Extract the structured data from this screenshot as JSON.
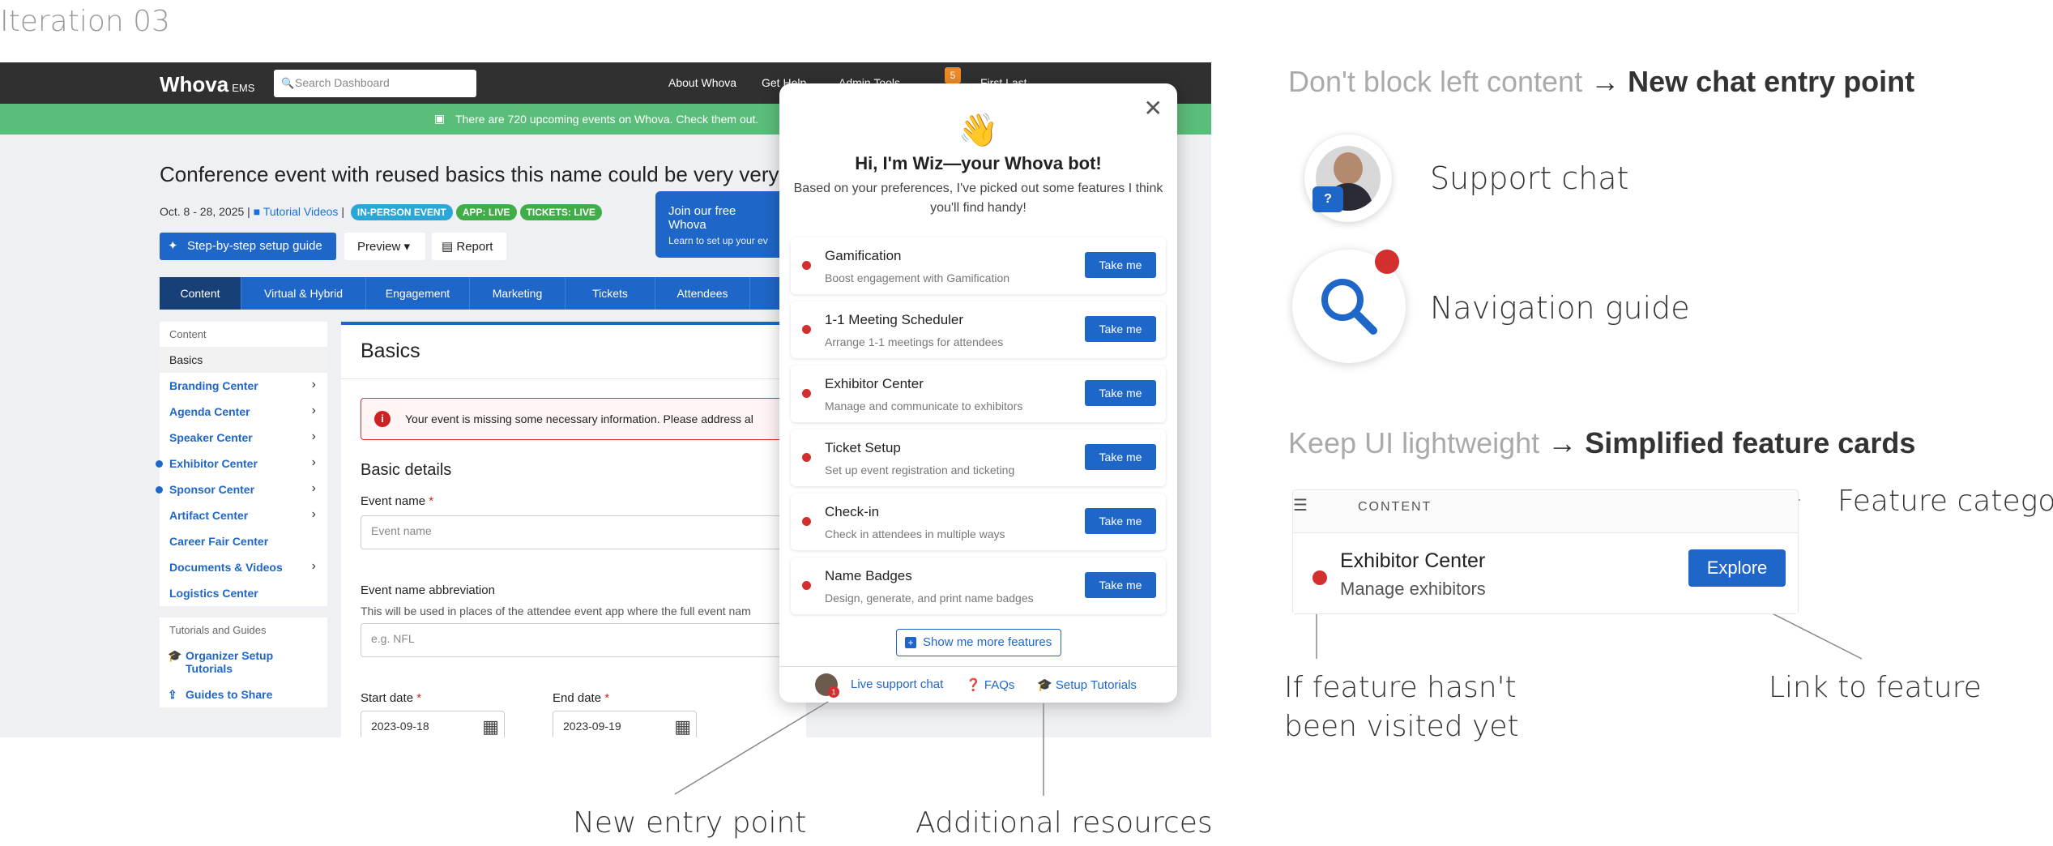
{
  "iteration_title": "Iteration 03",
  "app": {
    "logo": "Whova",
    "logo_suffix": "EMS",
    "search_placeholder": "Search Dashboard",
    "nav": [
      "About Whova",
      "Get Help",
      "Admin Tools",
      "First Last"
    ],
    "notification_count": "5",
    "banner": "There are 720 upcoming events on Whova. Check them out.",
    "event_title": "Conference event with reused basics this name could be very very lo",
    "event_dates": "Oct. 8 - 28, 2025",
    "tutorial_link": "Tutorial Videos",
    "pills": [
      {
        "label": "IN-PERSON EVENT",
        "color": "#2aa7d6"
      },
      {
        "label": "APP: LIVE",
        "color": "#3fae49"
      },
      {
        "label": "TICKETS: LIVE",
        "color": "#3fae49"
      }
    ],
    "setup_button": "Step-by-step setup guide",
    "preview_button": "Preview",
    "report_button": "Report",
    "join_title": "Join our free Whova",
    "join_sub": "Learn to set up your ev",
    "tabs": [
      "Content",
      "Virtual & Hybrid",
      "Engagement",
      "Marketing",
      "Tickets",
      "Attendees"
    ],
    "sidebar": {
      "header": "Content",
      "items": [
        {
          "label": "Basics"
        },
        {
          "label": "Branding Center"
        },
        {
          "label": "Agenda Center"
        },
        {
          "label": "Speaker Center"
        },
        {
          "label": "Exhibitor Center"
        },
        {
          "label": "Sponsor Center"
        },
        {
          "label": "Artifact Center"
        },
        {
          "label": "Career Fair Center"
        },
        {
          "label": "Documents & Videos"
        },
        {
          "label": "Logistics Center"
        }
      ],
      "guides_header": "Tutorials and Guides",
      "guides": [
        "Organizer Setup Tutorials",
        "Guides to Share"
      ]
    },
    "main": {
      "title": "Basics",
      "error": "Your event is missing some necessary information. Please address al",
      "section": "Basic details",
      "event_name_label": "Event name",
      "event_name_placeholder": "Event name",
      "abbr_label": "Event name abbreviation",
      "abbr_help": "This will be used in places of the attendee event app where the full event nam",
      "abbr_placeholder": "e.g. NFL",
      "start_label": "Start date",
      "start_value": "2023-09-18",
      "end_label": "End date",
      "end_value": "2023-09-19"
    }
  },
  "popup": {
    "wave": "👋",
    "heading": "Hi, I'm Wiz—your Whova bot!",
    "subtitle": "Based on your preferences, I've picked out some features I think you'll find handy!",
    "cards": [
      {
        "title": "Gamification",
        "sub": "Boost engagement with Gamification",
        "action": "Take me"
      },
      {
        "title": "1-1 Meeting Scheduler",
        "sub": "Arrange 1-1 meetings for attendees",
        "action": "Take me"
      },
      {
        "title": "Exhibitor Center",
        "sub": "Manage and communicate to exhibitors",
        "action": "Take me"
      },
      {
        "title": "Ticket Setup",
        "sub": "Set up event registration and ticketing",
        "action": "Take me"
      },
      {
        "title": "Check-in",
        "sub": "Check in attendees in multiple ways",
        "action": "Take me"
      },
      {
        "title": "Name Badges",
        "sub": "Design, generate, and print name badges",
        "action": "Take me"
      }
    ],
    "more_button": "Show me more features",
    "footer": {
      "chat": "Live support chat",
      "faqs": "FAQs",
      "tutorials": "Setup Tutorials"
    }
  },
  "annotations": {
    "heading1_a": "Don't block left content",
    "heading1_b": "New chat entry point",
    "support_chat": "Support chat",
    "nav_guide": "Navigation guide",
    "heading2_a": "Keep UI lightweight",
    "heading2_b": "Simplified feature cards",
    "content_label": "CONTENT",
    "feature_category": "Feature category",
    "sample_title": "Exhibitor Center",
    "sample_sub": "Manage exhibitors",
    "explore": "Explore",
    "not_visited_1": "If feature hasn't",
    "not_visited_2": "been visited yet",
    "link_to_feature": "Link to feature",
    "new_entry_point": "New entry point",
    "additional_resources": "Additional resources",
    "arrow": "→"
  }
}
